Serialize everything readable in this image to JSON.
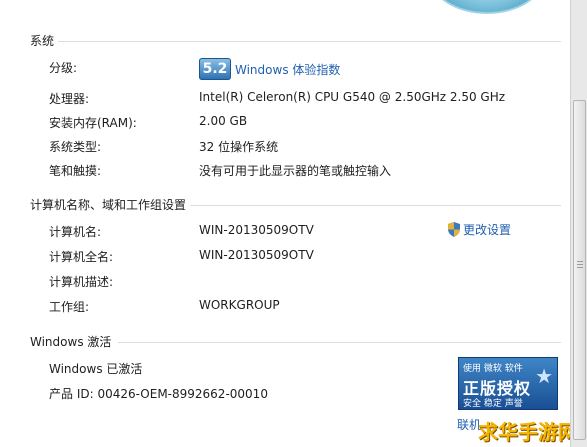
{
  "system": {
    "title": "系统",
    "rating_label": "分级:",
    "rating_score": "5.2",
    "rating_link": "Windows 体验指数",
    "processor_label": "处理器:",
    "processor_value": "Intel(R) Celeron(R) CPU G540 @ 2.50GHz   2.50 GHz",
    "ram_label": "安装内存(RAM):",
    "ram_value": "2.00 GB",
    "type_label": "系统类型:",
    "type_value": "32 位操作系统",
    "pen_label": "笔和触摸:",
    "pen_value": "没有可用于此显示器的笔或触控输入"
  },
  "computer": {
    "title": "计算机名称、域和工作组设置",
    "name_label": "计算机名:",
    "name_value": "WIN-20130509OTV",
    "fullname_label": "计算机全名:",
    "fullname_value": "WIN-20130509OTV",
    "desc_label": "计算机描述:",
    "workgroup_label": "工作组:",
    "workgroup_value": "WORKGROUP",
    "change_settings": "更改设置"
  },
  "activation": {
    "title": "Windows 激活",
    "status": "Windows 已激活",
    "product_id": "产品 ID: 00426-OEM-8992662-00010",
    "badge_top": "使用 微软 软件",
    "badge_main": "正版授权",
    "badge_bottom": "安全 稳定 声誉",
    "more_link": "联机"
  },
  "watermark": "求华手游网",
  "colors": {
    "link": "#1f5fb0",
    "badge": "#2a6fb0",
    "watermark": "#f5b400"
  }
}
